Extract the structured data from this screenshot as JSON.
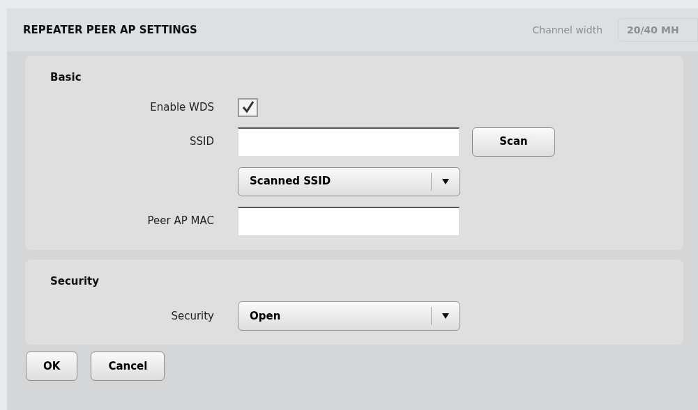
{
  "background": {
    "label": "Channel width",
    "value": "20/40 MH"
  },
  "dialog": {
    "title": "REPEATER PEER AP SETTINGS",
    "sections": [
      {
        "title": "Basic",
        "rows": [
          {
            "kind": "checkbox",
            "label": "Enable WDS",
            "checked": true
          },
          {
            "kind": "input",
            "label": "SSID",
            "value": "",
            "button": "Scan"
          },
          {
            "kind": "select",
            "label": "",
            "value": "Scanned SSID"
          },
          {
            "kind": "input",
            "label": "Peer AP MAC",
            "value": ""
          }
        ]
      },
      {
        "title": "Security",
        "rows": [
          {
            "kind": "select",
            "label": "Security",
            "value": "Open"
          }
        ]
      }
    ],
    "buttons": [
      "OK",
      "Cancel"
    ]
  }
}
